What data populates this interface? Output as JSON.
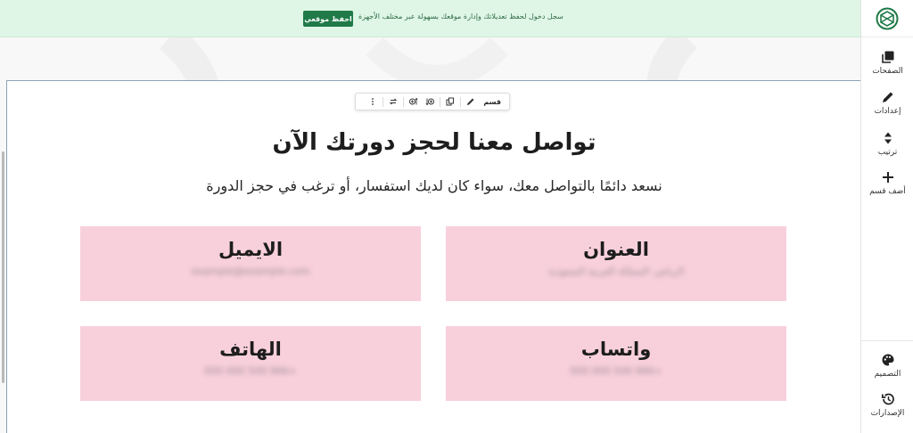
{
  "notice": {
    "message": "سجل دخول لحفظ تعديلاتك وإدارة موقعك بسهولة عبر مختلف الأجهزة",
    "save_button": "احفظ موقعي"
  },
  "sidebar": {
    "items": [
      {
        "label": "الصفحات",
        "icon": "pages-icon"
      },
      {
        "label": "إعدادات",
        "icon": "pencil-icon"
      },
      {
        "label": "ترتيب",
        "icon": "sort-icon"
      },
      {
        "label": "أضف قسم",
        "icon": "plus-icon"
      }
    ],
    "bottom_items": [
      {
        "label": "التصميم",
        "icon": "palette-icon"
      },
      {
        "label": "الإصدارات",
        "icon": "history-icon"
      }
    ]
  },
  "toolbar": {
    "label": "قسم"
  },
  "section": {
    "title": "تواصل معنا لحجز دورتك الآن",
    "subtitle": "نسعد دائمًا بالتواصل معك، سواء كان لديك استفسار، أو ترغب في حجز الدورة",
    "cards": [
      {
        "title": "العنوان",
        "value": "الرياض، المملكة العربية السعودية"
      },
      {
        "title": "الايميل",
        "value": "example@example.com"
      },
      {
        "title": "واتساب",
        "value": "+966 500 000 000"
      },
      {
        "title": "الهاتف",
        "value": "+966 500 000 000"
      }
    ]
  },
  "colors": {
    "accent": "#1f7a47",
    "notice_bg": "#dff6e6",
    "card_bg": "#f8d0dc"
  }
}
